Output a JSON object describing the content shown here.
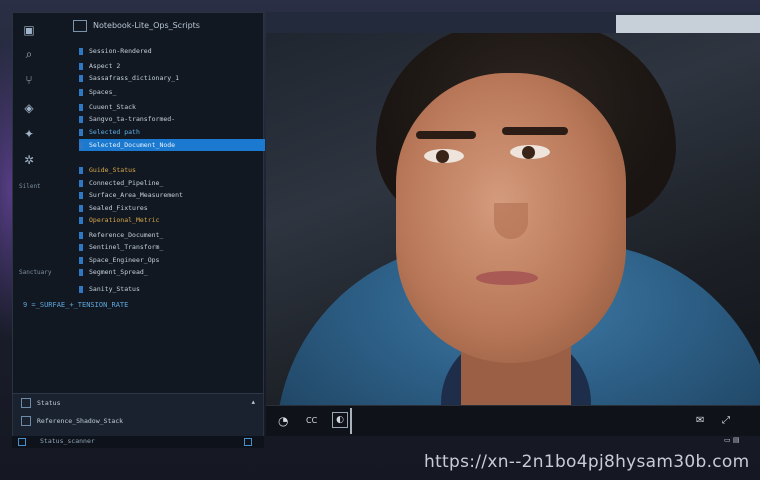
{
  "explorer": {
    "header": "Notebook-Lite_Ops_Scripts",
    "rows": [
      {
        "text": "Session-Rendered",
        "style": "normal"
      },
      {
        "text": "Aspect  2",
        "style": "normal"
      },
      {
        "text": "Sassafrass_dictionary_1",
        "style": "normal"
      },
      {
        "text": "Spaces_",
        "style": "normal"
      },
      {
        "text": "Cuuent_Stack",
        "style": "normal"
      },
      {
        "text": "Sangvo_ta-transformed-",
        "style": "normal"
      },
      {
        "text": "Selected path",
        "style": "blue"
      },
      {
        "text": "Selected_Document_Node",
        "style": "selected"
      },
      {
        "text": "Guide_Status",
        "style": "gold"
      },
      {
        "text": "Connected_Pipeline_",
        "style": "normal"
      },
      {
        "text": "Surface_Area_Measurement",
        "style": "normal"
      },
      {
        "text": "Sealed_Fixtures",
        "style": "normal"
      },
      {
        "text": "Operational_Metric",
        "style": "gold"
      },
      {
        "text": "Reference_Document_",
        "style": "normal"
      },
      {
        "text": "Sentinel_Transform_",
        "style": "normal"
      },
      {
        "text": "Space_Engineer_Ops",
        "style": "normal"
      },
      {
        "text": "Segment_Spread_",
        "style": "normal"
      },
      {
        "text": "Sanity_Status",
        "style": "normal"
      }
    ],
    "status_line": "9  =_SURFAE_+_TENSION_RATE"
  },
  "activity": [
    {
      "icon": "folder-icon"
    },
    {
      "icon": "search-icon"
    },
    {
      "icon": "source-control-icon"
    },
    {
      "icon": "debug-icon"
    },
    {
      "icon": "extensions-icon"
    },
    {
      "icon": "settings-icon"
    }
  ],
  "activity_labels": {
    "label_1": "Silent",
    "label_2": "Sanctuary"
  },
  "bottom_panel": {
    "row_1": "Status",
    "row_2": "Reference_Shadow_Stack",
    "taskbar_text": "Status_scanner"
  },
  "video": {
    "controls": {
      "play_icon": "play-icon",
      "subtitles_label": "CC",
      "volume_icon": "volume-icon",
      "fullscreen_icon": "fullscreen-icon"
    }
  },
  "watermark": "https://xn--2n1bo4pj8hysam30b.com"
}
